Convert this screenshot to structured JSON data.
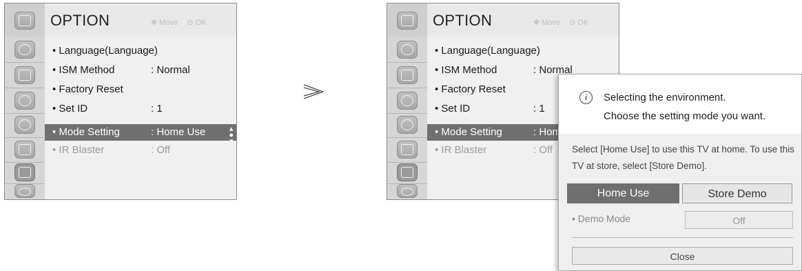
{
  "menu": {
    "title": "OPTION",
    "hint_move": "Move",
    "hint_ok": "OK",
    "items": [
      {
        "label": "• Language(Language)",
        "value": ""
      },
      {
        "label": "• ISM Method",
        "value": ": Normal"
      },
      {
        "label": "• Factory Reset",
        "value": ""
      },
      {
        "label": "• Set ID",
        "value": ": 1"
      },
      {
        "label": "• Mode Setting",
        "value": ": Home Use"
      },
      {
        "label": "• IR Blaster",
        "value": ": Off"
      }
    ],
    "right_mode_value": ": Hom"
  },
  "side_icons": [
    "picture-icon",
    "display-icon",
    "audio-icon",
    "clock-icon",
    "lock-icon",
    "option-icon",
    "network-icon"
  ],
  "dialog": {
    "line1": "Selecting the environment.",
    "line2": "Choose the setting mode you want.",
    "description": "Select [Home Use] to use this TV at home. To use this TV at store, select [Store Demo].",
    "home_use": "Home Use",
    "store_demo": "Store Demo",
    "demo_mode_label": "• Demo Mode",
    "demo_mode_value": "Off",
    "close": "Close"
  },
  "colors": {
    "highlight": "#707070",
    "header": "#e9e9e9",
    "sidebar": "#d6d6d6"
  }
}
